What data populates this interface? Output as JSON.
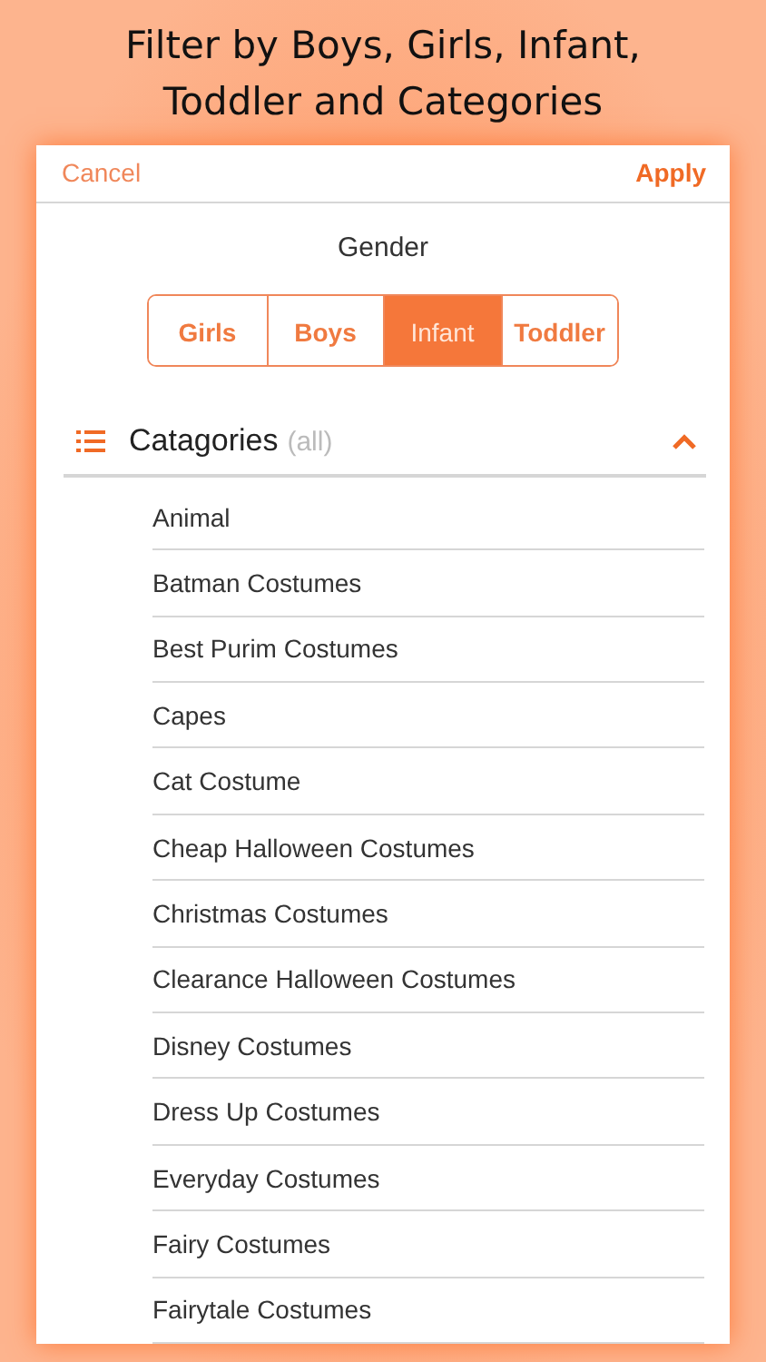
{
  "headline": "Filter by Boys, Girls, Infant, Toddler and Categories",
  "nav": {
    "cancel": "Cancel",
    "apply": "Apply"
  },
  "gender": {
    "title": "Gender",
    "options": [
      {
        "label": "Girls",
        "selected": false
      },
      {
        "label": "Boys",
        "selected": false
      },
      {
        "label": "Infant",
        "selected": true
      },
      {
        "label": "Toddler",
        "selected": false
      }
    ]
  },
  "categories": {
    "title": "Catagories",
    "hint": "(all)",
    "expanded": true,
    "items": [
      "Animal",
      "Batman Costumes",
      "Best Purim Costumes",
      "Capes",
      "Cat Costume",
      "Cheap Halloween Costumes",
      "Christmas Costumes",
      "Clearance Halloween Costumes",
      "Disney Costumes",
      "Dress Up Costumes",
      "Everyday Costumes",
      "Fairy Costumes",
      "Fairytale Costumes"
    ]
  }
}
